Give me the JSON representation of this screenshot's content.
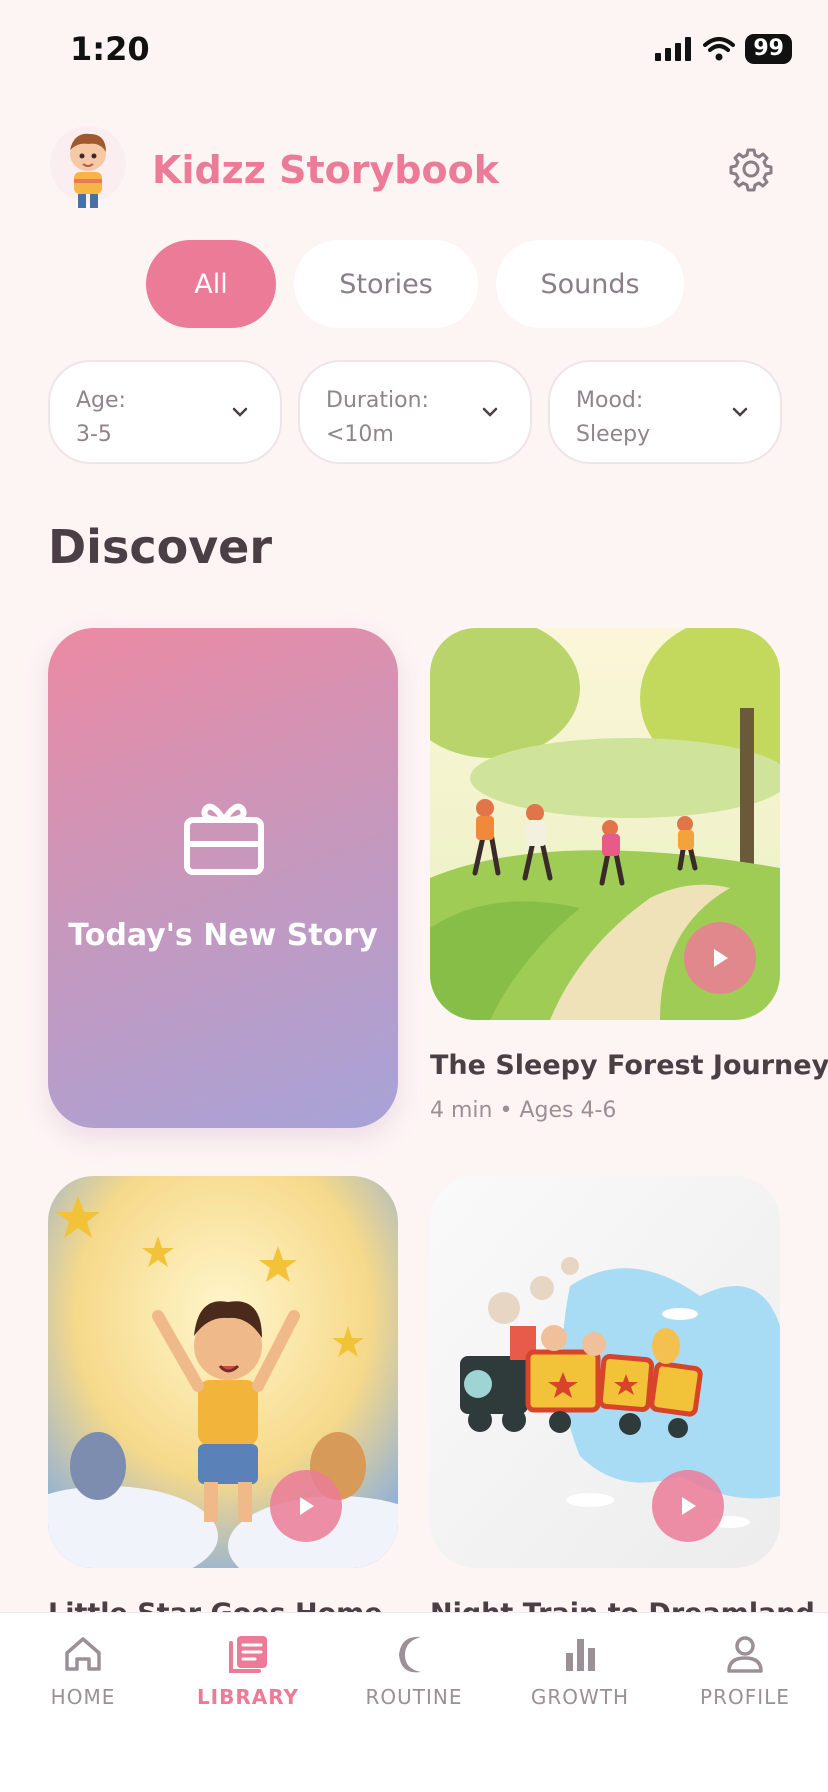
{
  "status_bar": {
    "time": "1:20",
    "battery": "99"
  },
  "header": {
    "title": "Kidzz Storybook"
  },
  "tabs": [
    {
      "label": "All",
      "active": true
    },
    {
      "label": "Stories",
      "active": false
    },
    {
      "label": "Sounds",
      "active": false
    }
  ],
  "filters": [
    {
      "label": "Age:",
      "value": "3-5"
    },
    {
      "label": "Duration:",
      "value": "<10m"
    },
    {
      "label": "Mood:",
      "value": "Sleepy"
    }
  ],
  "section": {
    "title": "Discover"
  },
  "featured": {
    "label": "Today's New Story"
  },
  "stories": [
    {
      "title": "The Sleepy Forest Journey",
      "meta": "4 min • Ages 4-6"
    },
    {
      "title": "Little Star Goes Home",
      "meta": ""
    },
    {
      "title": "Night Train to Dreamland",
      "meta": ""
    }
  ],
  "nav": [
    {
      "label": "HOME",
      "icon": "home-icon"
    },
    {
      "label": "LIBRARY",
      "icon": "library-icon",
      "active": true
    },
    {
      "label": "ROUTINE",
      "icon": "moon-icon"
    },
    {
      "label": "GROWTH",
      "icon": "bar-chart-icon"
    },
    {
      "label": "PROFILE",
      "icon": "person-icon"
    }
  ],
  "colors": {
    "accent": "#ec7b98",
    "background": "#fdf4f4"
  }
}
